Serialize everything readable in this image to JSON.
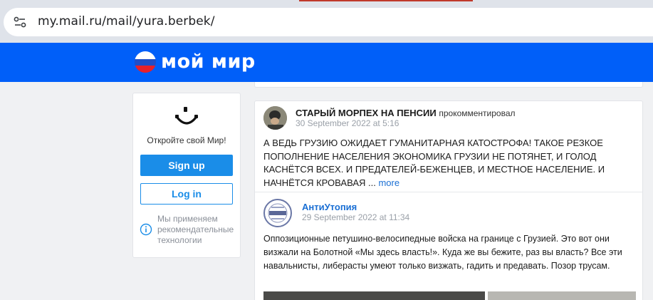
{
  "browser": {
    "url": "my.mail.ru/mail/yura.berbek/",
    "site_info_icon": "tune-icon"
  },
  "header": {
    "logo_text": "мой мир",
    "logo_colors": [
      "#ffffff",
      "#1f4ec8",
      "#e8202a"
    ],
    "brand_color": "#005ff9"
  },
  "sidebar": {
    "open_text": "Откройте свой Мир!",
    "signup_label": "Sign up",
    "login_label": "Log in",
    "rec_text": "Мы применяем рекомендательные технологии",
    "accent_color": "#1a8de8"
  },
  "post": {
    "author": "СТАРЫЙ МОРПЕХ НА ПЕНСИИ",
    "action": "прокомментировал",
    "date": "30 September 2022 at 5:16",
    "comment": "А ВЕДЬ ГРУЗИЮ ОЖИДАЕТ ГУМАНИТАРНАЯ КАТОСТРОФА! ТАКОЕ РЕЗКОЕ ПОПОЛНЕНИЕ НАСЕЛЕНИЯ ЭКОНОМИКА ГРУЗИИ НЕ ПОТЯНЕТ, И ГОЛОД КАСНЁТСЯ ВСЕХ. И ПРЕДАТЕЛЕЙ-БЕЖЕНЦЕВ, И МЕСТНОЕ НАСЕЛЕНИЕ. И НАЧНЁТСЯ КРОВАВАЯ ...",
    "more_label": "more",
    "original": {
      "author": "АнтиУтопия",
      "date": "29 September 2022 at 11:34",
      "text": "Оппозиционные петушино-велосипедные войска на границе с Грузией. Это вот они визжали на Болотной «Мы здесь власть!». Куда же вы бежите, раз вы власть? Все эти навальнисты, либерасты умеют только визжать, гадить и предавать. Позор трусам."
    }
  }
}
